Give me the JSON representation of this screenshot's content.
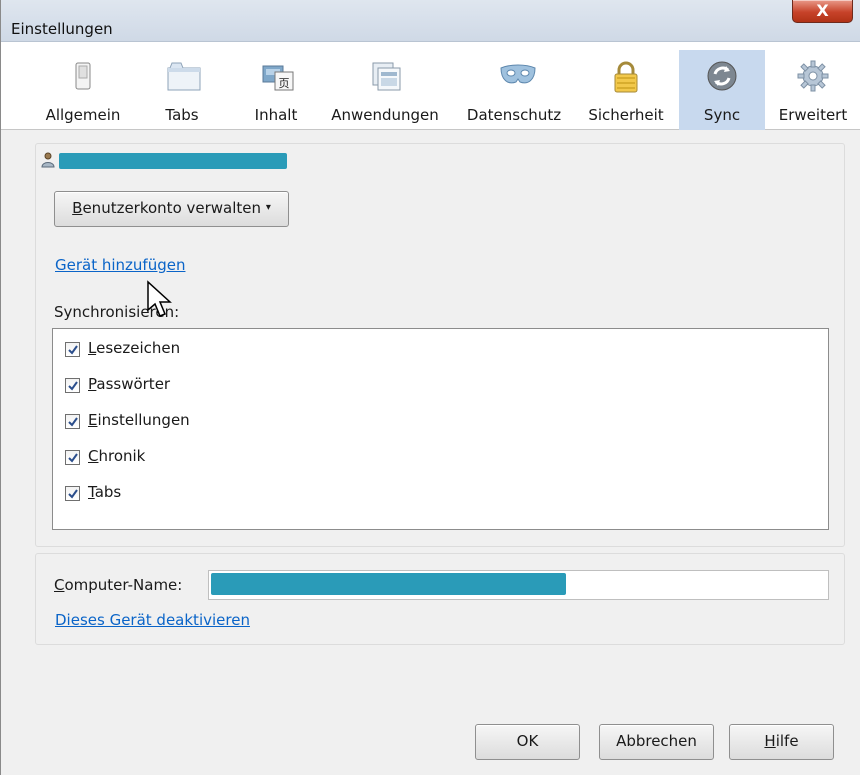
{
  "window": {
    "title": "Einstellungen",
    "close_label": "X"
  },
  "tabs": [
    {
      "label": "Allgemein",
      "icon": "switch-icon"
    },
    {
      "label": "Tabs",
      "icon": "tabs-icon"
    },
    {
      "label": "Inhalt",
      "icon": "content-icon"
    },
    {
      "label": "Anwendungen",
      "icon": "applications-icon"
    },
    {
      "label": "Datenschutz",
      "icon": "mask-icon"
    },
    {
      "label": "Sicherheit",
      "icon": "lock-icon"
    },
    {
      "label": "Sync",
      "icon": "sync-icon",
      "selected": true
    },
    {
      "label": "Erweitert",
      "icon": "gear-icon"
    }
  ],
  "account": {
    "manage_button": {
      "accesskey": "B",
      "rest": "enutzerkonto verwalten"
    },
    "add_device_link": "Gerät hinzufügen",
    "sync_label": "Synchronisieren:",
    "items": [
      {
        "accesskey": "L",
        "rest": "esezeichen",
        "checked": true
      },
      {
        "accesskey": "P",
        "rest": "asswörter",
        "checked": true
      },
      {
        "accesskey": "E",
        "rest": "instellungen",
        "checked": true
      },
      {
        "accesskey": "C",
        "rest": "hronik",
        "checked": true
      },
      {
        "accesskey": "T",
        "rest": "abs",
        "checked": true
      }
    ]
  },
  "device": {
    "computer_name_label": {
      "accesskey": "C",
      "rest": "omputer-Name:"
    },
    "deactivate_link": "Dieses Gerät deaktivieren"
  },
  "footer": {
    "ok": "OK",
    "cancel": "Abbrechen",
    "help": {
      "accesskey": "H",
      "rest": "ilfe"
    }
  },
  "colors": {
    "selected_tab": "#c8d9ee",
    "link": "#0a64c8",
    "redaction": "#2a9bb8"
  }
}
